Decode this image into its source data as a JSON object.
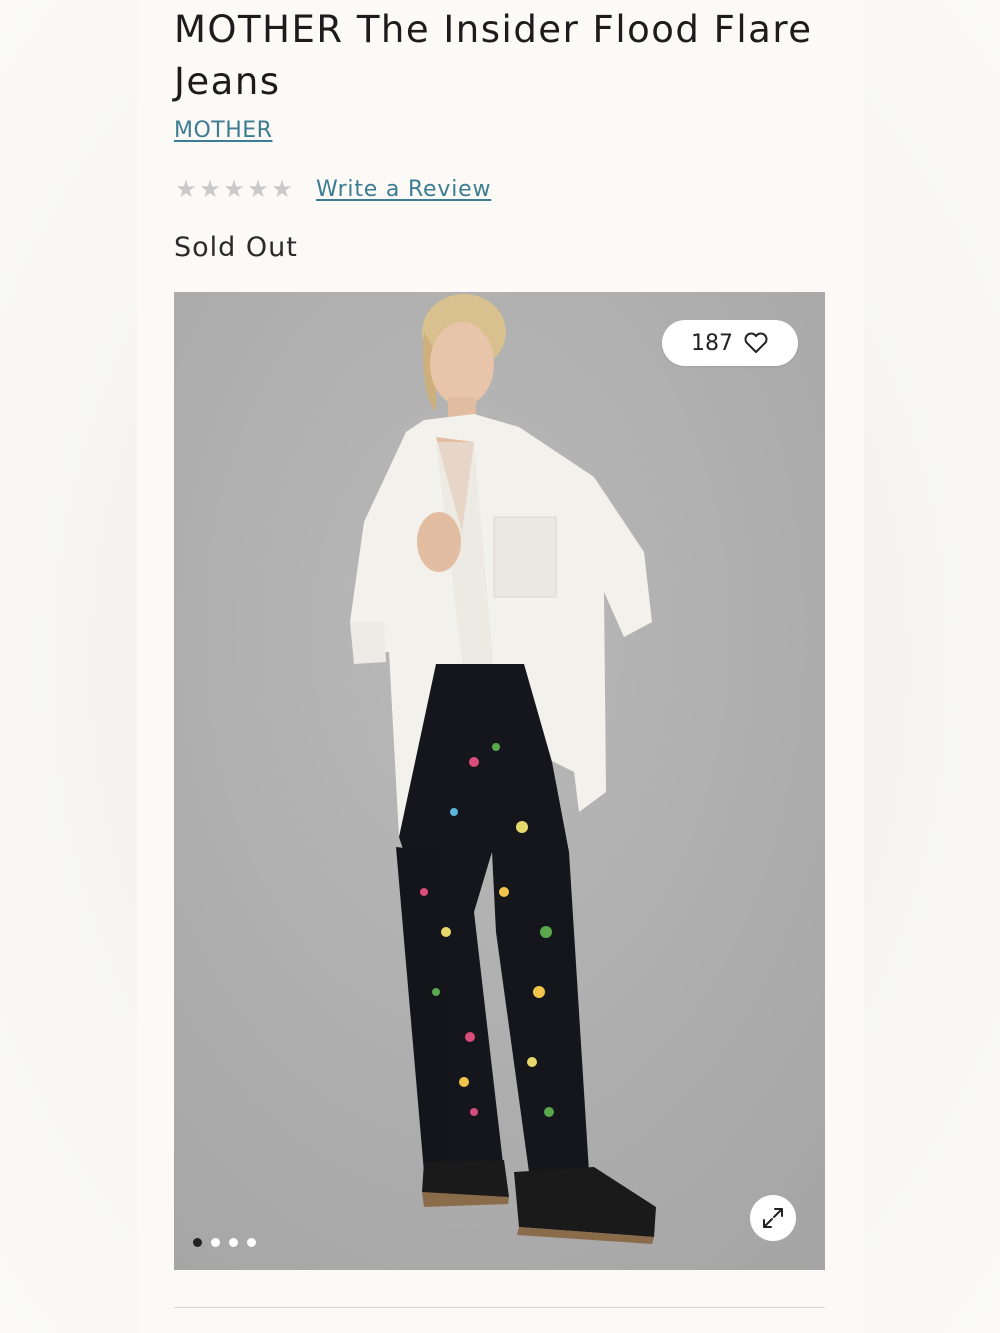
{
  "product": {
    "title": "MOTHER The Insider Flood Flare Jeans",
    "brand": "MOTHER",
    "rating": {
      "stars_filled": 0,
      "stars_total": 5,
      "write_review_label": "Write a Review"
    },
    "availability": "Sold Out"
  },
  "gallery": {
    "likes_count": "187",
    "like_icon": "heart-outline-icon",
    "expand_icon": "expand-arrows-icon",
    "image_count": 4,
    "active_index": 0
  },
  "colors": {
    "link": "#3d7c92",
    "star_empty": "#c9c9c9",
    "text": "#1c1c1c"
  }
}
